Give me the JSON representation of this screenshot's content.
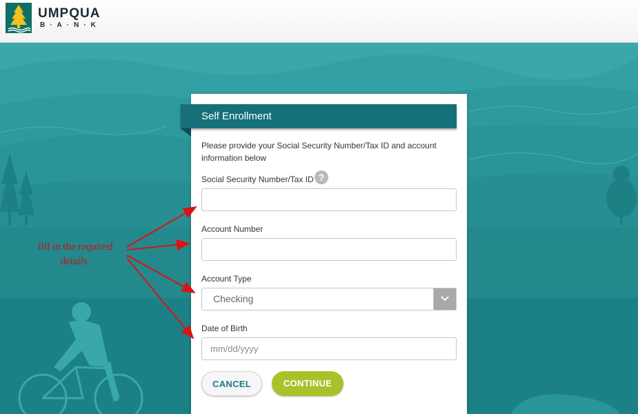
{
  "header": {
    "brand_name": "UMPQUA",
    "brand_sub": "B·A·N·K",
    "logo_icon": "tree-icon"
  },
  "form": {
    "title": "Self Enrollment",
    "intro": "Please provide your Social Security Number/Tax ID and account information below",
    "ssn": {
      "label": "Social Security Number/Tax ID",
      "value": "",
      "placeholder": "",
      "help_icon": "?"
    },
    "account_number": {
      "label": "Account Number",
      "value": "",
      "placeholder": ""
    },
    "account_type": {
      "label": "Account Type",
      "selected": "Checking"
    },
    "dob": {
      "label": "Date of Birth",
      "value": "",
      "placeholder": "mm/dd/yyyy"
    },
    "buttons": {
      "cancel": "CANCEL",
      "continue": "CONTINUE"
    }
  },
  "annotation": {
    "text": "fill in the required details",
    "color": "#c41212"
  },
  "colors": {
    "primary_teal": "#16707a",
    "continue_green": "#a9c22c",
    "background_teal": "#2c9a9e"
  }
}
